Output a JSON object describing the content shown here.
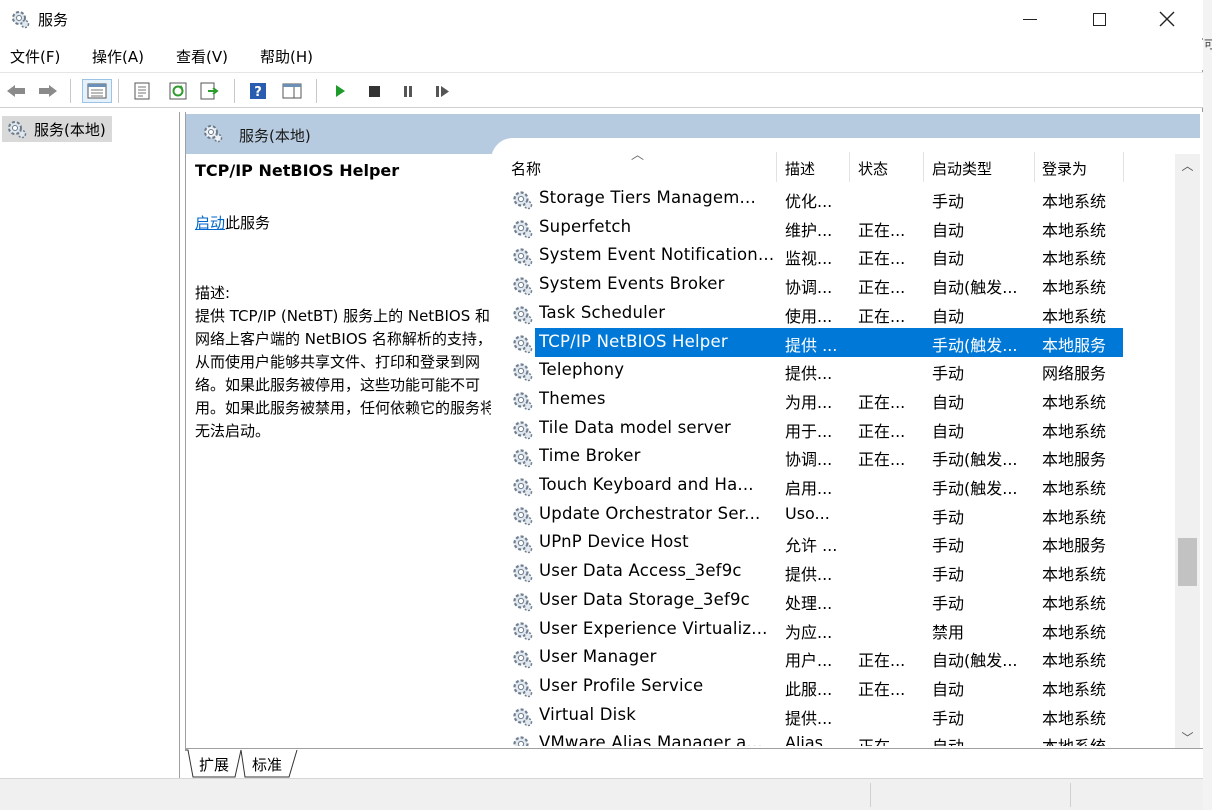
{
  "window": {
    "title": "服务"
  },
  "menu": [
    "文件(F)",
    "操作(A)",
    "查看(V)",
    "帮助(H)"
  ],
  "toolbar": {
    "items": [
      "back-icon",
      "forward-icon",
      "show-hide-console-tree-icon",
      "properties-icon",
      "refresh-icon",
      "export-list-icon",
      "help-icon",
      "action-pane-icon",
      "start-service-icon",
      "stop-service-icon",
      "pause-service-icon",
      "resume-service-icon"
    ]
  },
  "tree": {
    "root_label": "服务(本地)"
  },
  "pane": {
    "header_title": "服务(本地)"
  },
  "details": {
    "service_name": "TCP/IP NetBIOS Helper",
    "start_link": "启动",
    "start_suffix": "此服务",
    "desc_label": "描述:",
    "desc_text": "提供 TCP/IP (NetBT) 服务上的 NetBIOS 和网络上客户端的 NetBIOS 名称解析的支持，从而使用户能够共享文件、打印和登录到网络。如果此服务被停用，这些功能可能不可用。如果此服务被禁用，任何依赖它的服务将无法启动。"
  },
  "columns": [
    "名称",
    "描述",
    "状态",
    "启动类型",
    "登录为"
  ],
  "services": [
    {
      "name": "Storage Tiers Managem...",
      "desc": "优化...",
      "status": "",
      "startup": "手动",
      "logon": "本地系统"
    },
    {
      "name": "Superfetch",
      "desc": "维护...",
      "status": "正在...",
      "startup": "自动",
      "logon": "本地系统"
    },
    {
      "name": "System Event Notification...",
      "desc": "监视...",
      "status": "正在...",
      "startup": "自动",
      "logon": "本地系统"
    },
    {
      "name": "System Events Broker",
      "desc": "协调...",
      "status": "正在...",
      "startup": "自动(触发...",
      "logon": "本地系统"
    },
    {
      "name": "Task Scheduler",
      "desc": "使用...",
      "status": "正在...",
      "startup": "自动",
      "logon": "本地系统"
    },
    {
      "name": "TCP/IP NetBIOS Helper",
      "desc": "提供 ...",
      "status": "",
      "startup": "手动(触发...",
      "logon": "本地服务"
    },
    {
      "name": "Telephony",
      "desc": "提供...",
      "status": "",
      "startup": "手动",
      "logon": "网络服务"
    },
    {
      "name": "Themes",
      "desc": "为用...",
      "status": "正在...",
      "startup": "自动",
      "logon": "本地系统"
    },
    {
      "name": "Tile Data model server",
      "desc": "用于...",
      "status": "正在...",
      "startup": "自动",
      "logon": "本地系统"
    },
    {
      "name": "Time Broker",
      "desc": "协调...",
      "status": "正在...",
      "startup": "手动(触发...",
      "logon": "本地服务"
    },
    {
      "name": "Touch Keyboard and Ha...",
      "desc": "启用...",
      "status": "",
      "startup": "手动(触发...",
      "logon": "本地系统"
    },
    {
      "name": "Update Orchestrator Ser...",
      "desc": "Uso...",
      "status": "",
      "startup": "手动",
      "logon": "本地系统"
    },
    {
      "name": "UPnP Device Host",
      "desc": "允许 ...",
      "status": "",
      "startup": "手动",
      "logon": "本地服务"
    },
    {
      "name": "User Data Access_3ef9c",
      "desc": "提供...",
      "status": "",
      "startup": "手动",
      "logon": "本地系统"
    },
    {
      "name": "User Data Storage_3ef9c",
      "desc": "处理...",
      "status": "",
      "startup": "手动",
      "logon": "本地系统"
    },
    {
      "name": "User Experience Virtualiz...",
      "desc": "为应...",
      "status": "",
      "startup": "禁用",
      "logon": "本地系统"
    },
    {
      "name": "User Manager",
      "desc": "用户...",
      "status": "正在...",
      "startup": "自动(触发...",
      "logon": "本地系统"
    },
    {
      "name": "User Profile Service",
      "desc": "此服...",
      "status": "正在...",
      "startup": "自动",
      "logon": "本地系统"
    },
    {
      "name": "Virtual Disk",
      "desc": "提供...",
      "status": "",
      "startup": "手动",
      "logon": "本地系统"
    },
    {
      "name": "VMware Alias Manager a...",
      "desc": "Alias...",
      "status": "正在...",
      "startup": "自动",
      "logon": "本地系统"
    }
  ],
  "selected_index": 5,
  "tabs": [
    "扩展",
    "标准"
  ],
  "colors": {
    "selection": "#0078d7",
    "header_band": "#b7cbe0",
    "link": "#0066cc"
  }
}
